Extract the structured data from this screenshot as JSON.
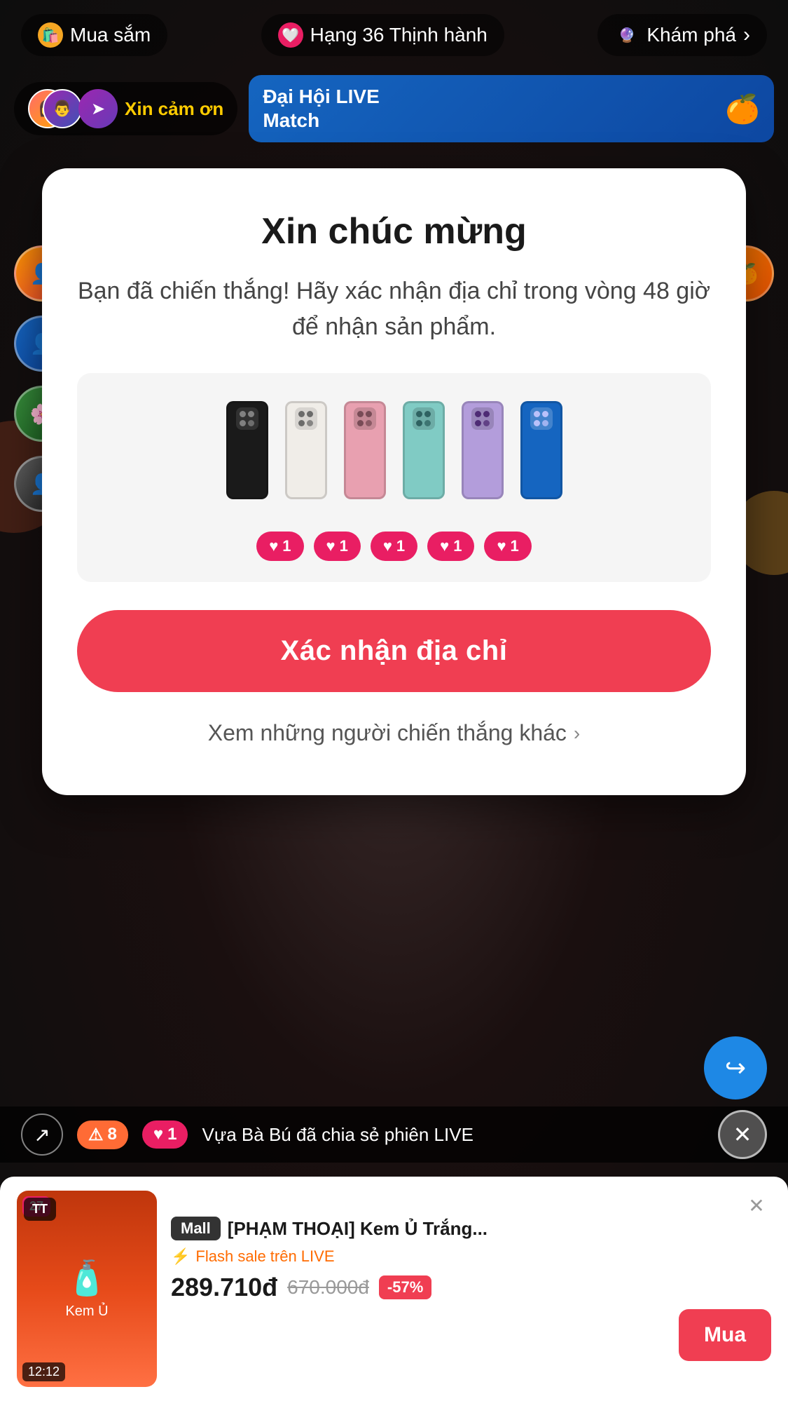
{
  "background": {
    "color": "#1a1a1a"
  },
  "top_bar": {
    "shopping_label": "Mua sắm",
    "rank_label": "Hạng 36 Thịnh hành",
    "explore_label": "Khám phá",
    "explore_icon": "›"
  },
  "notification": {
    "xin_cam_on_text": "Xin cảm ơn",
    "live_match_line1": "Đại Hội LIVE",
    "live_match_line2": "Match"
  },
  "modal": {
    "title": "Xin chúc mừng",
    "subtitle": "Bạn đã chiến thắng! Hãy xác nhận địa chỉ trong vòng 48 giờ để nhận sản phẩm.",
    "confirm_btn_label": "Xác nhận địa chỉ",
    "view_winners_label": "Xem những người chiến thắng khác",
    "view_winners_icon": "›",
    "phones": [
      {
        "color": "#1a1a1a",
        "label": "black"
      },
      {
        "color": "#f5f5f0",
        "label": "white"
      },
      {
        "color": "#f4a7b9",
        "label": "pink"
      },
      {
        "color": "#b2dfdb",
        "label": "teal"
      },
      {
        "color": "#c5b4e3",
        "label": "purple"
      },
      {
        "color": "#1565c0",
        "label": "blue"
      }
    ],
    "like_badges": [
      {
        "icon": "♥",
        "count": "1"
      },
      {
        "icon": "♥",
        "count": "1"
      },
      {
        "icon": "♥",
        "count": "1"
      },
      {
        "icon": "♥",
        "count": "1"
      },
      {
        "icon": "♥",
        "count": "1"
      }
    ]
  },
  "bottom_notif": {
    "alert_count": "8",
    "heart_count": "1",
    "description": "Vựa Bà Bú đã chia sẻ phiên LIVE",
    "share_icon": "↗",
    "close_icon": "✕"
  },
  "forward_btn": {
    "icon": "↪"
  },
  "product_card": {
    "count": "27",
    "mall_label": "Mall",
    "product_name": "[PHẠM THOẠI] Kem Ủ Trắng...",
    "flash_sale_label": "Flash sale trên LIVE",
    "flash_icon": "⚡",
    "price_new": "289.710đ",
    "price_old": "670.000đ",
    "discount": "-57%",
    "buy_label": "Mua",
    "close_icon": "✕",
    "time": "12:12",
    "tiktok_shop": "TikTok Shop"
  }
}
